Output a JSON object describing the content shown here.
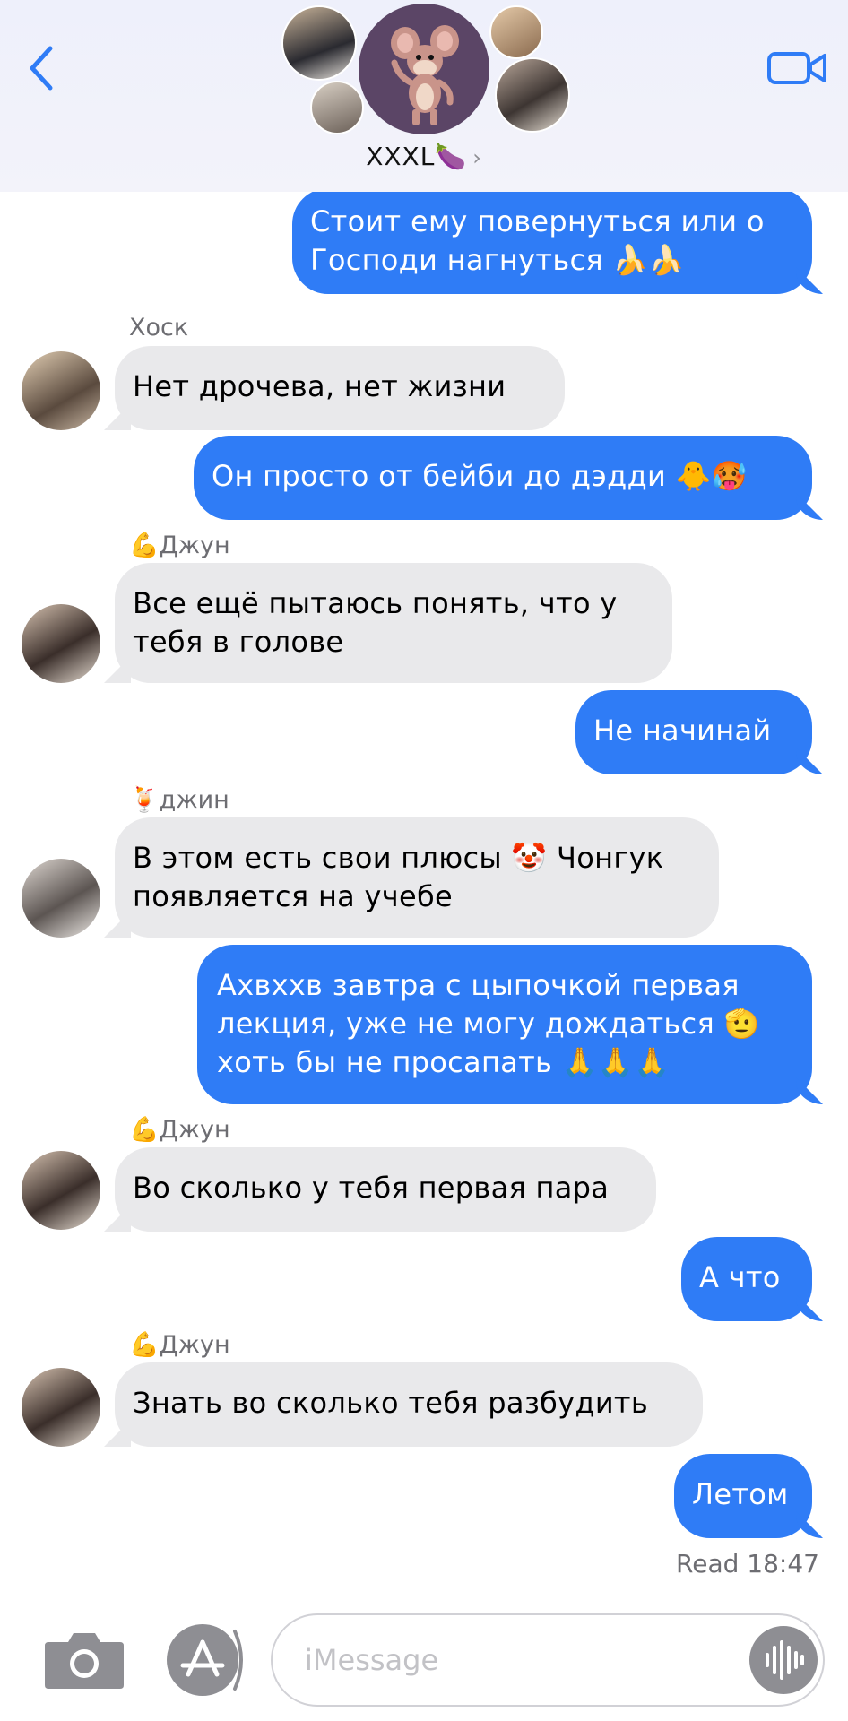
{
  "header": {
    "group_name": "XXXL🍆",
    "chevron": "›"
  },
  "messages": [
    {
      "dir": "out",
      "text": "Стоит ему повернуться или о Господи нагнуться 🍌🍌"
    },
    {
      "dir": "in",
      "sender": "Хоск",
      "text": "Нет дрочева,  нет жизни"
    },
    {
      "dir": "out",
      "text": "Он просто  от бейби до дэдди 🐥🥵"
    },
    {
      "dir": "in",
      "sender": "💪Джун",
      "text": "Все ещё пытаюсь понять,  что у тебя в голове"
    },
    {
      "dir": "out",
      "text": "Не начинай"
    },
    {
      "dir": "in",
      "sender": "🍹джин",
      "text": "В этом есть свои плюсы 🤡 Чонгук появляется на учебе"
    },
    {
      "dir": "out",
      "text": "Ахвххв завтра с цыпочкой  первая лекция,  уже не могу дождаться 🫡 хоть бы не просапать 🙏🙏🙏"
    },
    {
      "dir": "in",
      "sender": "💪Джун",
      "text": "Во сколько у тебя первая пара"
    },
    {
      "dir": "out",
      "text": "А что"
    },
    {
      "dir": "in",
      "sender": "💪Джун",
      "text": "Знать во сколько тебя разбудить"
    },
    {
      "dir": "out",
      "text": "Летом"
    }
  ],
  "receipt": {
    "label": "Read",
    "time": "18:47"
  },
  "composer": {
    "placeholder": "iMessage"
  },
  "colors": {
    "outgoing": "#2f7cf6",
    "incoming": "#e9e9eb",
    "accent": "#2f7cf6"
  },
  "icons": [
    "back-chevron-icon",
    "video-camera-icon",
    "camera-icon",
    "app-store-icon",
    "voice-memo-icon"
  ]
}
